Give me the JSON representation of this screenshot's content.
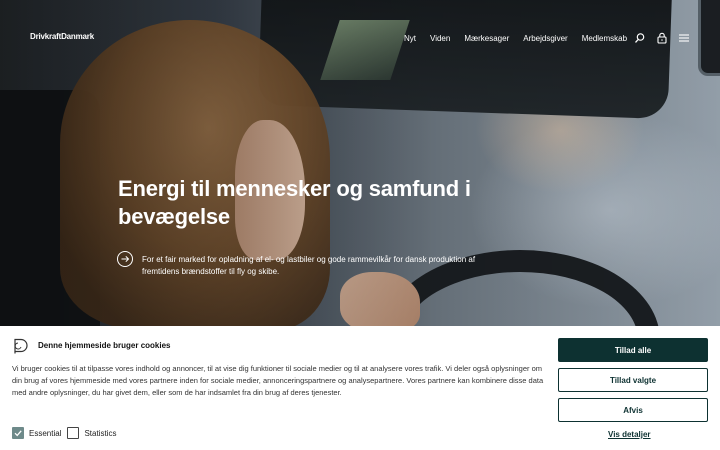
{
  "header": {
    "logo_text": "DrivkraftDanmark",
    "nav": [
      "Nyt",
      "Viden",
      "Mærkesager",
      "Arbejdsgiver",
      "Medlemskab"
    ],
    "icons": [
      "search-icon",
      "lock-icon",
      "menu-icon"
    ]
  },
  "hero": {
    "title": "Energi til mennesker og samfund i bevægelse",
    "description": "For et fair marked for opladning af el- og lastbiler og gode rammevilkår for dansk produktion af fremtidens brændstoffer til fly og skibe.",
    "arrow_icon": "arrow-right-icon"
  },
  "cookie": {
    "title": "Denne hjemmeside bruger cookies",
    "text": "Vi bruger cookies til at tilpasse vores indhold og annoncer, til at vise dig funktioner til sociale medier og til at analysere vores trafik. Vi deler også oplysninger om din brug af vores hjemmeside med vores partnere inden for sociale medier, annonceringspartnere og analysepartnere. Vores partnere kan kombinere disse data med andre oplysninger, du har givet dem, eller som de har indsamlet fra din brug af deres tjenester.",
    "checkboxes": [
      {
        "label": "Essential",
        "checked": true
      },
      {
        "label": "Statistics",
        "checked": false
      }
    ],
    "buttons": {
      "allow_all": "Tillad alle",
      "allow_selected": "Tillad valgte",
      "reject": "Afvis"
    },
    "details_link": "Vis detaljer"
  },
  "colors": {
    "primary": "#0d3131",
    "checkbox_checked": "#6e8a8a"
  }
}
